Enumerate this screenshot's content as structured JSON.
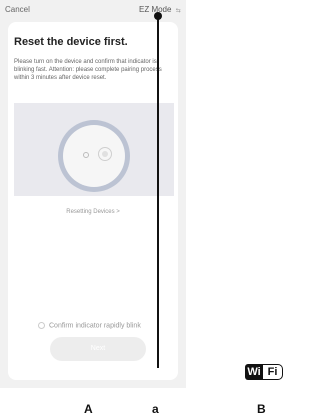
{
  "topbar": {
    "cancel_label": "Cancel",
    "mode_label": "EZ Mode",
    "mode_icon": "⇆"
  },
  "content": {
    "title": "Reset the device first.",
    "description": "Please turn on the device and confirm that indicator is blinking fast. Attention: please complete pairing process within 3 minutes after device reset.",
    "resetting_link": "Resetting Devices >",
    "confirm_label": "Confirm indicator rapidly blink",
    "next_label": "Next"
  },
  "callouts": {
    "label_A": "A",
    "label_a": "a",
    "label_B": "B"
  },
  "wifi_logo": {
    "wi": "Wi",
    "fi": "Fi"
  },
  "colors": {
    "background": "#f1f1f1",
    "card": "#ffffff",
    "illustration_bg": "#e9e9ee",
    "device_ring": "#bcc3d3",
    "next_button": "#ededed"
  }
}
